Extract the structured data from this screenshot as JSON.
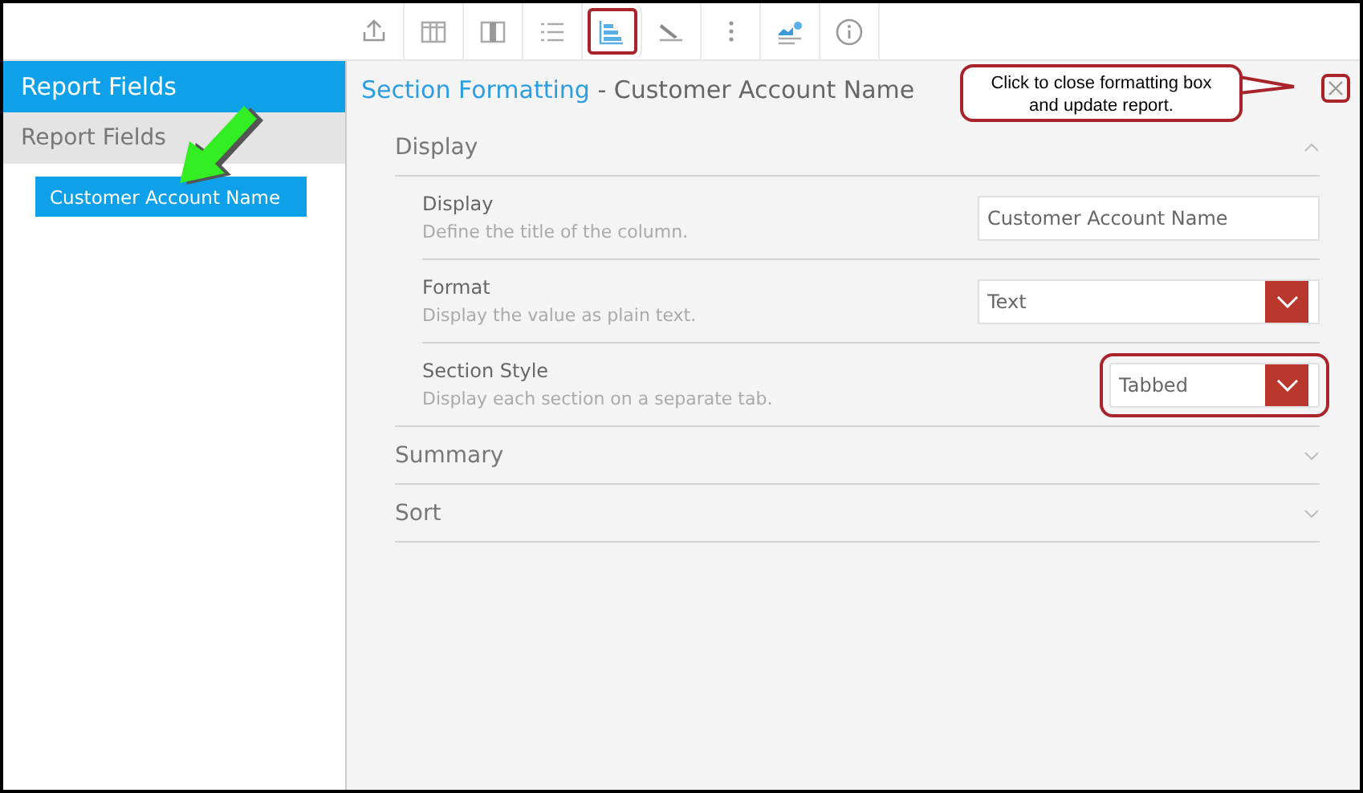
{
  "toolbar": [
    {
      "kind": "upload",
      "selected": false
    },
    {
      "kind": "table",
      "selected": false
    },
    {
      "kind": "column",
      "selected": false
    },
    {
      "kind": "list",
      "selected": false
    },
    {
      "kind": "sections",
      "selected": true
    },
    {
      "kind": "pencil",
      "selected": false
    },
    {
      "kind": "dots",
      "selected": false
    },
    {
      "kind": "chart",
      "selected": false
    },
    {
      "kind": "info",
      "selected": false
    }
  ],
  "sidebar": {
    "title": "Report Fields",
    "group": "Report Fields",
    "items": [
      {
        "label": "Customer Account Name",
        "selected": true
      }
    ]
  },
  "panel": {
    "title": "Section Formatting",
    "subtitle": " - Customer Account Name",
    "sections": [
      {
        "title": "Display",
        "expanded": true,
        "fields": [
          {
            "kind": "text",
            "label": "Display",
            "hint": "Define the title of the column.",
            "value": "Customer Account Name",
            "highlighted": false
          },
          {
            "kind": "select",
            "label": "Format",
            "hint": "Display the value as plain text.",
            "value": "Text",
            "highlighted": false
          },
          {
            "kind": "select",
            "label": "Section Style",
            "hint": "Display each section on a separate tab.",
            "value": "Tabbed",
            "highlighted": true
          }
        ]
      },
      {
        "title": "Summary",
        "expanded": false
      },
      {
        "title": "Sort",
        "expanded": false
      }
    ]
  },
  "callout": {
    "text": "Click to close formatting box and update report."
  }
}
